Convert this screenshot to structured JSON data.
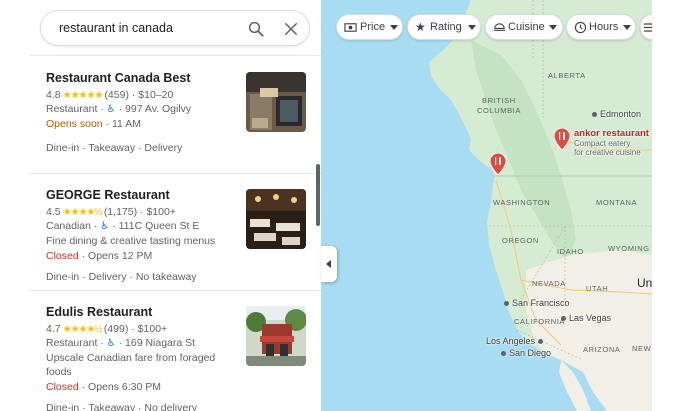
{
  "search": {
    "query": "restaurant in canada"
  },
  "results": [
    {
      "name": "Restaurant Canada Best",
      "rating": "4.8",
      "stars": "★★★★★",
      "reviews": "(459)",
      "price": "$10–20",
      "category": "Restaurant",
      "address": "997 Av. Ogilvy",
      "description": "",
      "status": "Opens soon",
      "status_detail": "11 AM",
      "services": "Dine-in · Takeaway · Delivery"
    },
    {
      "name": "GEORGE Restaurant",
      "rating": "4.5",
      "stars": "★★★★½",
      "reviews": "(1,175)",
      "price": "$100+",
      "category": "Canadian",
      "address": "111C Queen St E",
      "description": "Fine dining & creative tasting menus",
      "status": "Closed",
      "status_detail": "Opens 12 PM",
      "services": "Dine-in · Delivery · No takeaway"
    },
    {
      "name": "Edulis Restaurant",
      "rating": "4.7",
      "stars": "★★★★½",
      "reviews": "(499)",
      "price": "$100+",
      "category": "Restaurant",
      "address": "169 Niagara St",
      "description_line1": "Upscale Canadian fare from foraged",
      "description_line2": "foods",
      "status": "Closed",
      "status_detail": "Opens 6:30 PM",
      "services": "Dine-in · Takeaway · No delivery"
    }
  ],
  "filters": [
    {
      "label": "Price",
      "icon": "money-icon"
    },
    {
      "label": "Rating",
      "icon": "star-icon"
    },
    {
      "label": "Cuisine",
      "icon": "cuisine-icon"
    },
    {
      "label": "Hours",
      "icon": "clock-icon"
    }
  ],
  "map": {
    "regions": [
      "ALBERTA",
      "BRITISH",
      "COLUMBIA",
      "WASHINGTON",
      "MONTANA",
      "OREGON",
      "IDAHO",
      "WYOMING",
      "NEVADA",
      "UTAH",
      "CALIFORNIA",
      "ARIZONA",
      "NEW MEXICO"
    ],
    "cities": [
      "Edmonton",
      "San Francisco",
      "Las Vegas",
      "Los Angeles",
      "San Diego"
    ],
    "partial_label": "Un",
    "pin": {
      "name": "ankor restaurant",
      "line1": "Compact eatery",
      "line2": "for creative cuisine"
    }
  },
  "colors": {
    "water": "#a8dcf2",
    "land": "#d5ecd3",
    "mountain": "#c4e3c0",
    "desert": "#f1efe6",
    "pin": "#e6483b",
    "accent": "#1a73e8"
  }
}
